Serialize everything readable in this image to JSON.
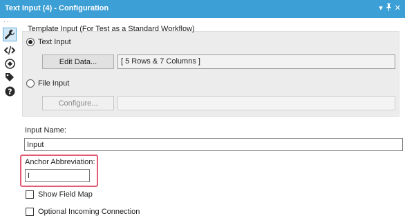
{
  "window": {
    "title": "Text Input (4) - Configuration",
    "controls": [
      "▾",
      "ᵽ",
      "✕"
    ]
  },
  "toolbar": {
    "icons": [
      "wrench-icon",
      "code-icon",
      "navigate-icon",
      "tag-icon",
      "help-icon"
    ]
  },
  "template_group": {
    "label": "Template Input (For Test as a Standard Workflow)",
    "text_input_label": "Text Input",
    "text_input_selected": true,
    "edit_data_label": "Edit Data...",
    "data_summary": "[ 5 Rows & 7 Columns ]",
    "file_input_label": "File Input",
    "file_input_selected": false,
    "configure_label": "Configure...",
    "file_path_value": ""
  },
  "input_name": {
    "label": "Input Name:",
    "value": "Input"
  },
  "anchor": {
    "label": "Anchor Abbreviation:",
    "value": "I"
  },
  "options": {
    "show_field_map_label": "Show Field Map",
    "show_field_map_checked": false,
    "optional_connection_label": "Optional Incoming Connection",
    "optional_connection_checked": false
  },
  "colors": {
    "titlebar": "#3c9fd6",
    "highlight": "#e35b75"
  }
}
